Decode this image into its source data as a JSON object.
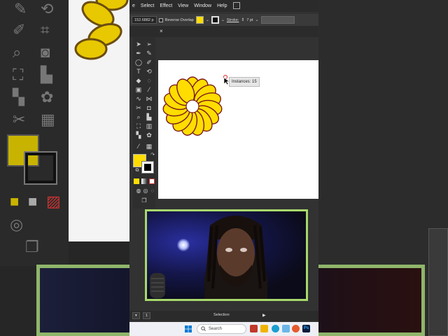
{
  "menu": {
    "items": [
      "e",
      "Select",
      "Effect",
      "View",
      "Window",
      "Help"
    ]
  },
  "control_bar": {
    "coordinate_value": "152.6882 p",
    "reverse_overlap_label": "Reverse Overlap",
    "fill_color": "#ffdd00",
    "stroke_label": "Stroke:",
    "stroke_weight": "7 pt"
  },
  "artboard": {
    "tooltip": "Instances: 15",
    "flower_petal_count": 15,
    "petal_fill": "#ffdd00",
    "petal_stroke": "#7a1a1a"
  },
  "status": {
    "artboard_number": "1",
    "current_tool": "Selection"
  },
  "taskbar": {
    "search_placeholder": "Search"
  },
  "colors": {
    "webcam_border": "#a8d86b",
    "accent_fill": "#ffdd00"
  }
}
